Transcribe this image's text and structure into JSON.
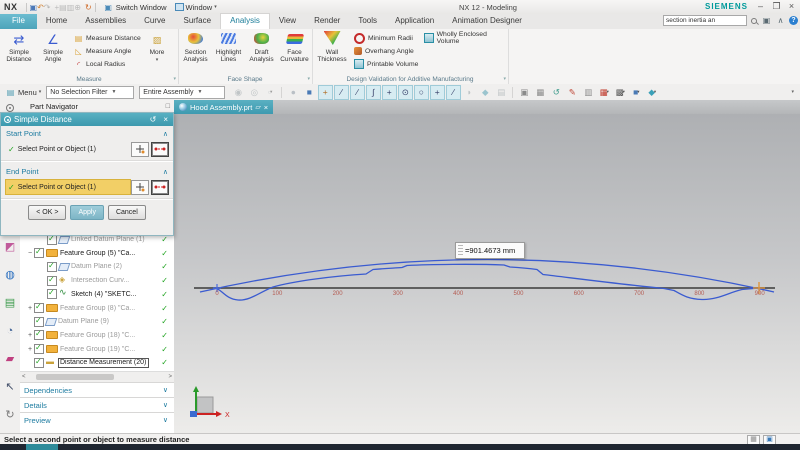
{
  "titlebar": {
    "logo": "NX",
    "switch_window": "Switch Window",
    "window_menu": "Window",
    "title": "NX 12 - Modeling",
    "brand": "SIEMENS",
    "quick_icons": [
      {
        "name": "save-icon",
        "glyph": "▣",
        "color": "#4a78b8"
      },
      {
        "name": "undo-icon",
        "glyph": "↶",
        "color": "#d08030"
      },
      {
        "name": "redo-icon",
        "glyph": "↷",
        "color": "#b4b4b4"
      },
      {
        "sep": true
      },
      {
        "name": "cut-icon",
        "glyph": "+",
        "color": "#bcbcbc"
      },
      {
        "name": "copy-icon",
        "glyph": "▤",
        "color": "#bcbcbc"
      },
      {
        "name": "paste-icon",
        "glyph": "▥",
        "color": "#bcbcbc"
      },
      {
        "name": "add-component-icon",
        "glyph": "⊕",
        "color": "#bcbcbc"
      },
      {
        "sep": true
      },
      {
        "name": "repeat-command-icon",
        "glyph": "↻",
        "color": "#d06a28"
      }
    ]
  },
  "tabs": {
    "file": "File",
    "items": [
      "Home",
      "Assemblies",
      "Curve",
      "Surface",
      "Analysis",
      "View",
      "Render",
      "Tools",
      "Application",
      "Animation Designer"
    ],
    "active": "Analysis",
    "search_value": "section inertia an"
  },
  "ribbon": {
    "measure": {
      "label": "Measure",
      "big1": "Simple Distance",
      "big2": "Simple Angle",
      "rows": [
        "Measure Distance",
        "Measure Angle",
        "Local Radius"
      ],
      "more": "More"
    },
    "face_shape": {
      "label": "Face Shape",
      "buttons": [
        "Section Analysis",
        "Highlight Lines",
        "Draft Analysis",
        "Face Curvature"
      ]
    },
    "additive": {
      "label": "Design Validation for Additive Manufacturing",
      "big1": "Wall Thickness",
      "rows": [
        "Minimum Radii",
        "Overhang Angle",
        "Printable Volume"
      ],
      "extra": "Wholly Enclosed Volume"
    }
  },
  "toolbar": {
    "menu": "Menu",
    "selection_filter": "No Selection Filter",
    "scope": "Entire Assembly",
    "icons": [
      {
        "name": "snap-point-dialog-icon",
        "glyph": "◉",
        "color": "#9aa4a8",
        "state": "gray"
      },
      {
        "name": "snap-sphere-icon",
        "glyph": "◎",
        "color": "#9aa4a8",
        "state": "gray"
      },
      {
        "name": "select-rectangle-icon",
        "glyph": "▫",
        "color": "#9aa4a8",
        "state": "gray",
        "arrow": true
      },
      {
        "sep": true
      },
      {
        "name": "shaded-ball-icon",
        "glyph": "●",
        "color": "#8e9aa6",
        "state": "gray"
      },
      {
        "name": "work-plane-icon",
        "glyph": "■",
        "color": "#4a7ab5",
        "state": "off"
      },
      {
        "name": "snap-point-icon",
        "glyph": "+",
        "color": "#b06a20",
        "state": "on"
      },
      {
        "name": "snap-endpoint-icon",
        "glyph": "∕",
        "color": "#38406a",
        "state": "on"
      },
      {
        "name": "snap-midpoint-icon",
        "glyph": "∕",
        "color": "#38406a",
        "state": "on"
      },
      {
        "name": "snap-curve-icon",
        "glyph": "∫",
        "color": "#38406a",
        "state": "on"
      },
      {
        "name": "snap-pole-icon",
        "glyph": "+",
        "color": "#38406a",
        "state": "on"
      },
      {
        "name": "snap-center-icon",
        "glyph": "⊙",
        "color": "#38406a",
        "state": "on"
      },
      {
        "name": "snap-circle-icon",
        "glyph": "○",
        "color": "#38406a",
        "state": "on"
      },
      {
        "name": "snap-intersection-icon",
        "glyph": "+",
        "color": "#38406a",
        "state": "on"
      },
      {
        "name": "snap-tangent-icon",
        "glyph": "∕",
        "color": "#38406a",
        "state": "on"
      },
      {
        "name": "snap-face-icon",
        "glyph": "◗",
        "color": "#9aa4a8",
        "state": "gray"
      },
      {
        "name": "snap-facet-icon",
        "glyph": "◆",
        "color": "#56a2b4",
        "state": "gray"
      },
      {
        "name": "snap-mesh-icon",
        "glyph": "▤",
        "color": "#9aa4a8",
        "state": "gray"
      },
      {
        "sep": true
      },
      {
        "name": "window-cascade-icon",
        "glyph": "▣",
        "color": "#8a8a8a",
        "state": "off"
      },
      {
        "name": "export-image-icon",
        "glyph": "▦",
        "color": "#8a8a8a",
        "state": "off"
      },
      {
        "name": "refresh-icon",
        "glyph": "↺",
        "color": "#3a9a8a",
        "state": "off"
      },
      {
        "name": "annotate-icon",
        "glyph": "✎",
        "color": "#c04a3a",
        "state": "off"
      },
      {
        "name": "layer-settings-icon",
        "glyph": "▥",
        "color": "#8a8a8a",
        "state": "off"
      },
      {
        "name": "grid-icon",
        "glyph": "▦",
        "color": "#c0392b",
        "state": "off",
        "arrow": true
      },
      {
        "name": "render-style-icon",
        "glyph": "▩",
        "color": "#5a5a5a",
        "state": "off",
        "arrow": true
      },
      {
        "name": "orient-view-icon",
        "glyph": "■",
        "color": "#4a7ab5",
        "state": "off",
        "arrow": true
      },
      {
        "name": "effects-icon",
        "glyph": "◆",
        "color": "#3aa0b8",
        "state": "off",
        "arrow": true
      }
    ]
  },
  "rail": {
    "icons": [
      {
        "name": "roles-icon",
        "glyph": "◩",
        "color": "#c05a9a"
      },
      {
        "name": "assembly-navigator-icon",
        "glyph": "◍",
        "color": "#2a6fbf"
      },
      {
        "name": "file-navigator-icon",
        "glyph": "▤",
        "color": "#3a9a4a"
      },
      {
        "name": "history-icon",
        "glyph": "◔",
        "color": "#4a6a9a"
      },
      {
        "name": "palette-icon",
        "glyph": "▰",
        "color": "#c04080"
      },
      {
        "name": "touch-icon",
        "glyph": "↖",
        "color": "#44506a"
      },
      {
        "name": "macro-icon",
        "glyph": "↻",
        "color": "#7a7a7a"
      }
    ]
  },
  "navigator": {
    "title": "Part Navigator",
    "tree": [
      {
        "label": "Linked Datum Plane (1)",
        "muted": true,
        "icon": "datum-plane",
        "indent": 1,
        "expander": ""
      },
      {
        "label": "Feature Group (5) \"Ca...",
        "muted": false,
        "icon": "folder",
        "indent": 0,
        "expander": "−"
      },
      {
        "label": "Datum Plane (2)",
        "muted": true,
        "icon": "datum-plane",
        "indent": 1,
        "expander": ""
      },
      {
        "label": "Intersection Curv...",
        "muted": true,
        "icon": "intersection-curve",
        "indent": 1,
        "expander": ""
      },
      {
        "label": "Sketch (4) \"SKETC...",
        "muted": false,
        "icon": "sketch",
        "indent": 1,
        "expander": ""
      },
      {
        "label": "Feature Group (8) \"Ca...",
        "muted": true,
        "icon": "folder",
        "indent": 0,
        "expander": "+"
      },
      {
        "label": "Datum Plane (9)",
        "muted": true,
        "icon": "datum-plane",
        "indent": 0,
        "expander": ""
      },
      {
        "label": "Feature Group (18) \"C...",
        "muted": true,
        "icon": "folder",
        "indent": 0,
        "expander": "+"
      },
      {
        "label": "Feature Group (19) \"C...",
        "muted": true,
        "icon": "folder",
        "indent": 0,
        "expander": "+"
      },
      {
        "label": "Distance Measurement (20)",
        "muted": false,
        "icon": "measurement",
        "indent": 0,
        "expander": "",
        "boxed": true
      }
    ],
    "sections": [
      "Dependencies",
      "Details",
      "Preview"
    ]
  },
  "dialog": {
    "title": "Simple Distance",
    "start_label": "Start Point",
    "start_row": "Select Point or Object (1)",
    "end_label": "End Point",
    "end_row": "Select Point or Object (1)",
    "ok": "< OK >",
    "apply": "Apply",
    "cancel": "Cancel"
  },
  "graphics": {
    "tab": "Hood Assembly.prt",
    "measurement": "=901.4673 mm",
    "ruler_labels": [
      "0",
      "100",
      "200",
      "300",
      "400",
      "500",
      "600",
      "700",
      "800",
      "900"
    ],
    "axis_label": "X"
  },
  "statusbar": {
    "message": "Select a second point or object to measure distance"
  },
  "colors": {
    "accent_teal": "#3d99ae",
    "file_tab_teal": "#4da4ba",
    "highlight_yellow": "#f2cf66",
    "curve_blue": "#3a5bd0",
    "ruler_text": "#b45a50",
    "marker_orange": "#e0963c",
    "check_green": "#1fa31f",
    "brand_teal": "#009a9b"
  }
}
